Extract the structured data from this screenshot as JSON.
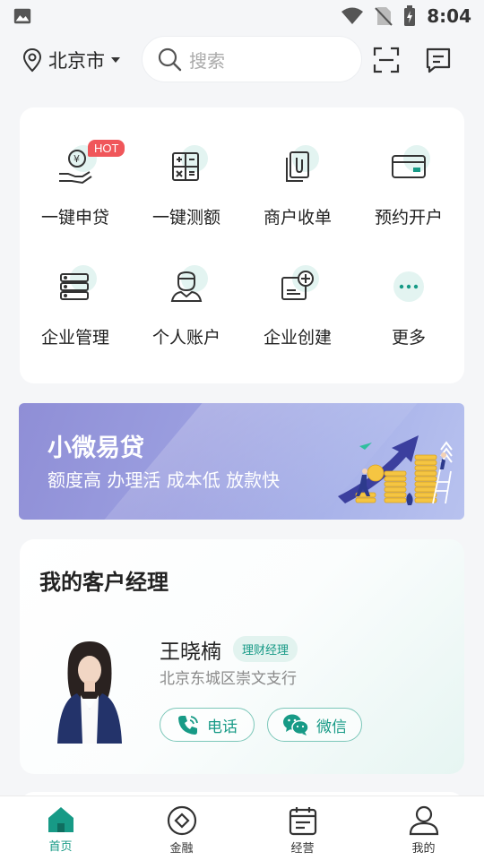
{
  "status_bar": {
    "time": "8:04"
  },
  "header": {
    "city": "北京市",
    "search_placeholder": "搜索"
  },
  "quick_menu": {
    "hot_badge": "HOT",
    "items": [
      {
        "label": "一键申贷",
        "icon": "loan-hand-icon"
      },
      {
        "label": "一键测额",
        "icon": "calculator-icon"
      },
      {
        "label": "商户收单",
        "icon": "receipt-clip-icon"
      },
      {
        "label": "预约开户",
        "icon": "bank-card-icon"
      },
      {
        "label": "企业管理",
        "icon": "server-stack-icon"
      },
      {
        "label": "个人账户",
        "icon": "person-icon"
      },
      {
        "label": "企业创建",
        "icon": "add-document-icon"
      },
      {
        "label": "更多",
        "icon": "more-dots-icon"
      }
    ]
  },
  "banner": {
    "title": "小微易贷",
    "subtitle": "额度高 办理活 成本低 放款快"
  },
  "manager": {
    "section_title": "我的客户经理",
    "name": "王晓楠",
    "tag": "理财经理",
    "branch": "北京东城区崇文支行",
    "call_label": "电话",
    "wechat_label": "微信"
  },
  "tabbar": {
    "tabs": [
      {
        "label": "首页",
        "active": true
      },
      {
        "label": "金融"
      },
      {
        "label": "经营"
      },
      {
        "label": "我的"
      }
    ]
  },
  "colors": {
    "accent": "#179a86",
    "hot": "#f0565a",
    "banner": "#9b9fe0"
  }
}
